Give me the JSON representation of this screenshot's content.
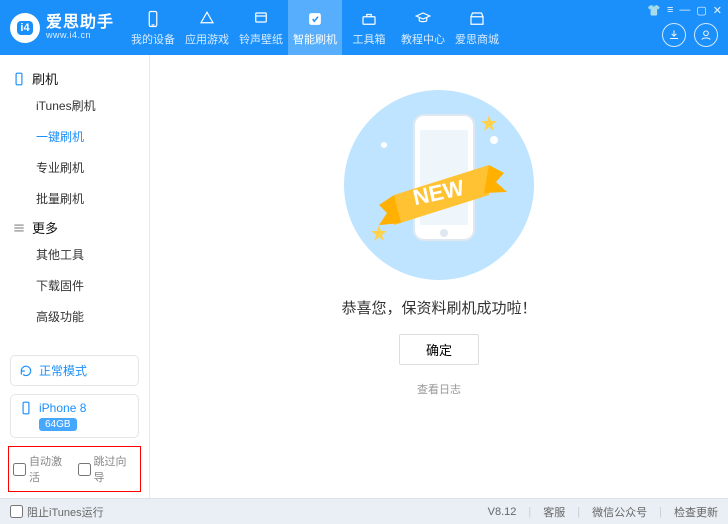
{
  "brand": {
    "title": "爱思助手",
    "subtitle": "www.i4.cn",
    "badge": "i4"
  },
  "nav": {
    "items": [
      {
        "label": "我的设备"
      },
      {
        "label": "应用游戏"
      },
      {
        "label": "铃声壁纸"
      },
      {
        "label": "智能刷机"
      },
      {
        "label": "工具箱"
      },
      {
        "label": "教程中心"
      },
      {
        "label": "爱思商城"
      }
    ],
    "active_index": 3
  },
  "sidebar": {
    "group1": {
      "title": "刷机",
      "items": [
        "iTunes刷机",
        "一键刷机",
        "专业刷机",
        "批量刷机"
      ],
      "active_index": 1
    },
    "group2": {
      "title": "更多",
      "items": [
        "其他工具",
        "下载固件",
        "高级功能"
      ]
    },
    "status": "正常模式",
    "device": {
      "name": "iPhone 8",
      "capacity": "64GB"
    },
    "opt_auto_activate": "自动激活",
    "opt_skip_guide": "跳过向导"
  },
  "main": {
    "success_text": "恭喜您，保资料刷机成功啦！",
    "ok": "确定",
    "view_log": "查看日志",
    "new_badge": "NEW"
  },
  "footer": {
    "block_itunes": "阻止iTunes运行",
    "version": "V8.12",
    "service": "客服",
    "wechat": "微信公众号",
    "check_update": "检查更新"
  }
}
